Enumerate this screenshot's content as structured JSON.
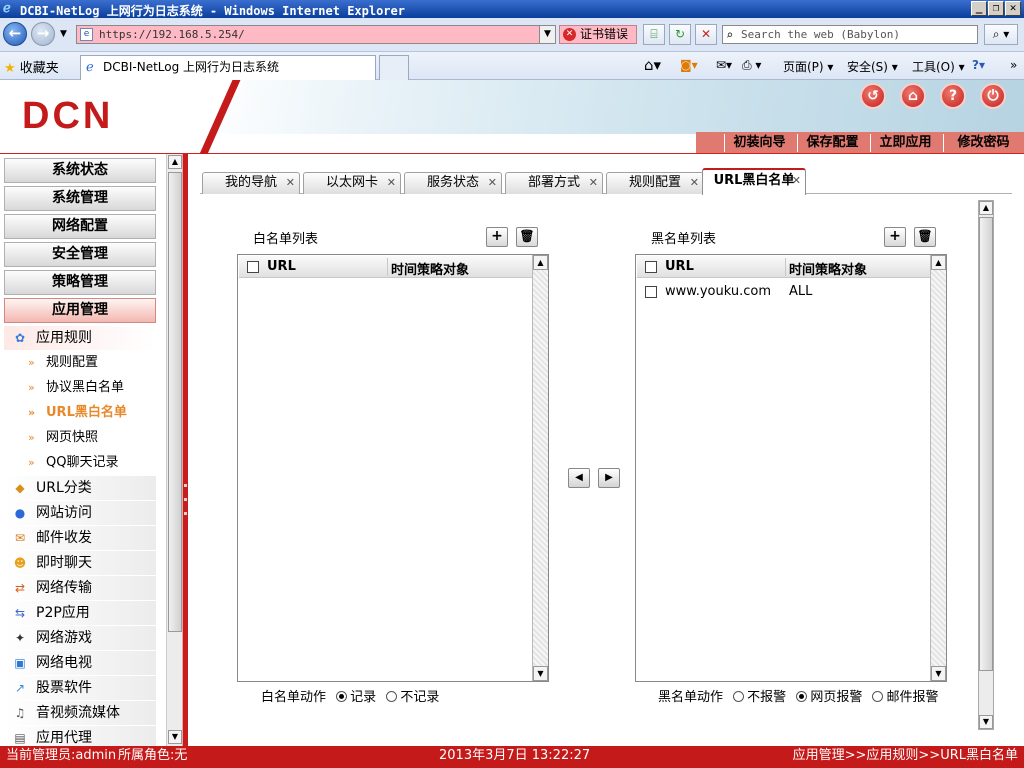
{
  "window": {
    "title": "DCBI-NetLog 上网行为日志系统 - Windows Internet Explorer",
    "minimize": "_",
    "restore": "❐",
    "close": "✕"
  },
  "browser": {
    "url": "https://192.168.5.254/",
    "cert_error": "证书错误",
    "search_placeholder": "Search the web (Babylon)",
    "favorites": "收藏夹",
    "tab_title": "DCBI-NetLog 上网行为日志系统",
    "menu": {
      "page": "页面(P)",
      "safety": "安全(S)",
      "tools": "工具(O)"
    }
  },
  "app": {
    "logo": "DCN",
    "quick_actions": [
      "初装向导",
      "保存配置",
      "立即应用",
      "修改密码"
    ],
    "header_icons": [
      "refresh-icon",
      "home-icon",
      "help-icon",
      "logout-icon"
    ]
  },
  "sidebar": {
    "groups": [
      "系统状态",
      "系统管理",
      "网络配置",
      "安全管理",
      "策略管理",
      "应用管理"
    ],
    "open_section": "应用规则",
    "leaves": [
      "规则配置",
      "协议黑白名单",
      "URL黑白名单",
      "网页快照",
      "QQ聊天记录"
    ],
    "active_leaf": "URL黑白名单",
    "sections": [
      {
        "label": "URL分类",
        "icon": "box-icon"
      },
      {
        "label": "网站访问",
        "icon": "globe-icon"
      },
      {
        "label": "邮件收发",
        "icon": "mail-icon"
      },
      {
        "label": "即时聊天",
        "icon": "chat-icon"
      },
      {
        "label": "网络传输",
        "icon": "transfer-icon"
      },
      {
        "label": "P2P应用",
        "icon": "p2p-icon"
      },
      {
        "label": "网络游戏",
        "icon": "gamepad-icon"
      },
      {
        "label": "网络电视",
        "icon": "tv-icon"
      },
      {
        "label": "股票软件",
        "icon": "stock-icon"
      },
      {
        "label": "音视频流媒体",
        "icon": "media-icon"
      },
      {
        "label": "应用代理",
        "icon": "proxy-icon"
      }
    ]
  },
  "tabs": [
    {
      "label": "我的导航",
      "active": false
    },
    {
      "label": "以太网卡",
      "active": false
    },
    {
      "label": "服务状态",
      "active": false
    },
    {
      "label": "部署方式",
      "active": false
    },
    {
      "label": "规则配置",
      "active": false
    },
    {
      "label": "URL黑白名单",
      "active": true
    }
  ],
  "whitelist": {
    "title": "白名单列表",
    "columns": [
      "URL",
      "时间策略对象"
    ],
    "rows": [],
    "action_label": "白名单动作",
    "options": [
      {
        "label": "记录",
        "selected": true
      },
      {
        "label": "不记录",
        "selected": false
      }
    ]
  },
  "blacklist": {
    "title": "黑名单列表",
    "columns": [
      "URL",
      "时间策略对象"
    ],
    "rows": [
      {
        "url": "www.youku.com",
        "policy": "ALL"
      }
    ],
    "action_label": "黑名单动作",
    "options": [
      {
        "label": "不报警",
        "selected": false
      },
      {
        "label": "网页报警",
        "selected": true
      },
      {
        "label": "邮件报警",
        "selected": false
      }
    ]
  },
  "status": {
    "admin": "当前管理员:admin",
    "role": "所属角色:无",
    "datetime": "2013年3月7日 13:22:27",
    "breadcrumb": "应用管理>>应用规则>>URL黑白名单"
  },
  "colors": {
    "brand_red": "#c41a1a",
    "active_orange": "#e8892c",
    "cert_error_bg": "#ffb9c4"
  }
}
